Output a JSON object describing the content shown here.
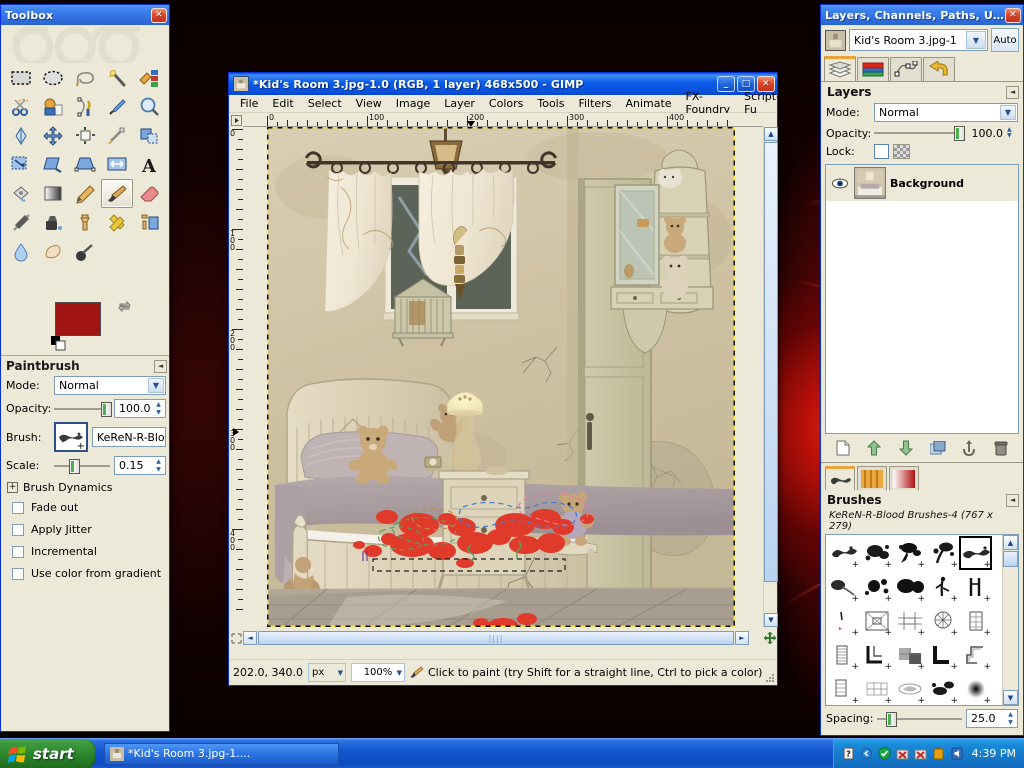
{
  "desktop": {
    "background_color": "#120202",
    "accent_color": "#ff2a12"
  },
  "toolbox": {
    "title": "Toolbox",
    "close_label": "✕",
    "tools": [
      {
        "name": "rect-select-tool",
        "label": "Rectangle Select"
      },
      {
        "name": "ellipse-select-tool",
        "label": "Ellipse Select"
      },
      {
        "name": "free-select-tool",
        "label": "Free Select"
      },
      {
        "name": "fuzzy-select-tool",
        "label": "Fuzzy Select"
      },
      {
        "name": "select-by-color-tool",
        "label": "Select by Color"
      },
      {
        "name": "scissors-select-tool",
        "label": "Scissors Select"
      },
      {
        "name": "foreground-select-tool",
        "label": "Foreground Select"
      },
      {
        "name": "paths-tool",
        "label": "Paths"
      },
      {
        "name": "color-picker-tool",
        "label": "Color Picker"
      },
      {
        "name": "zoom-tool",
        "label": "Zoom"
      },
      {
        "name": "measure-tool",
        "label": "Measure"
      },
      {
        "name": "move-tool",
        "label": "Move"
      },
      {
        "name": "alignment-tool",
        "label": "Alignment"
      },
      {
        "name": "crop-tool",
        "label": "Crop"
      },
      {
        "name": "rotate-tool",
        "label": "Rotate"
      },
      {
        "name": "scale-tool",
        "label": "Scale"
      },
      {
        "name": "shear-tool",
        "label": "Shear"
      },
      {
        "name": "perspective-tool",
        "label": "Perspective"
      },
      {
        "name": "flip-tool",
        "label": "Flip"
      },
      {
        "name": "text-tool",
        "label": "Text"
      },
      {
        "name": "bucket-fill-tool",
        "label": "Bucket Fill"
      },
      {
        "name": "gradient-tool",
        "label": "Blend"
      },
      {
        "name": "pencil-tool",
        "label": "Pencil"
      },
      {
        "name": "paintbrush-tool",
        "label": "Paintbrush"
      },
      {
        "name": "eraser-tool",
        "label": "Eraser"
      },
      {
        "name": "airbrush-tool",
        "label": "Airbrush"
      },
      {
        "name": "ink-tool",
        "label": "Ink"
      },
      {
        "name": "clone-tool",
        "label": "Clone"
      },
      {
        "name": "heal-tool",
        "label": "Heal"
      },
      {
        "name": "perspective-clone-tool",
        "label": "Perspective Clone"
      },
      {
        "name": "blur-sharpen-tool",
        "label": "Blur / Sharpen"
      },
      {
        "name": "smudge-tool",
        "label": "Smudge"
      },
      {
        "name": "dodge-burn-tool",
        "label": "Dodge / Burn"
      }
    ],
    "selected_tool_index": 23,
    "colors": {
      "foreground": "#a01414",
      "background": "#ffffff"
    },
    "tool_options": {
      "title": "Paintbrush",
      "mode_label": "Mode:",
      "mode_value": "Normal",
      "opacity_label": "Opacity:",
      "opacity_value": "100.0",
      "brush_label": "Brush:",
      "brush_value": "KeReN-R-Blood Br",
      "scale_label": "Scale:",
      "scale_value": "0.15",
      "brush_dynamics_label": "Brush Dynamics",
      "checkboxes": [
        {
          "label": "Fade out",
          "checked": false
        },
        {
          "label": "Apply Jitter",
          "checked": false
        },
        {
          "label": "Incremental",
          "checked": false
        },
        {
          "label": "Use color from gradient",
          "checked": false
        }
      ]
    }
  },
  "image_window": {
    "title": "*Kid's Room 3.jpg-1.0 (RGB, 1 layer) 468x500 - GIMP",
    "minimize_label": "_",
    "maximize_label": "□",
    "close_label": "✕",
    "menus": [
      "File",
      "Edit",
      "Select",
      "View",
      "Image",
      "Layer",
      "Colors",
      "Tools",
      "Filters",
      "Animate",
      "FX-Foundry",
      "Script-Fu"
    ],
    "ruler_h_labels": [
      "0",
      "100",
      "200",
      "300",
      "400"
    ],
    "ruler_v_labels": [
      "0",
      "100",
      "200",
      "300",
      "400"
    ],
    "status": {
      "position": "202.0, 340.0",
      "unit": "px",
      "zoom": "100%",
      "message": "Click to paint (try Shift for a straight line, Ctrl to pick a color)"
    }
  },
  "dock": {
    "title": "Layers, Channels, Paths, Undo -...",
    "close_label": "✕",
    "image_name": "Kid's Room 3.jpg-1",
    "auto_label": "Auto",
    "tabs": [
      {
        "name": "layers-tab",
        "label": "Layers"
      },
      {
        "name": "channels-tab",
        "label": "Channels"
      },
      {
        "name": "paths-tab",
        "label": "Paths"
      },
      {
        "name": "undo-history-tab",
        "label": "Undo History"
      }
    ],
    "active_tab": 0,
    "layers_panel": {
      "title": "Layers",
      "mode_label": "Mode:",
      "mode_value": "Normal",
      "opacity_label": "Opacity:",
      "opacity_value": "100.0",
      "lock_label": "Lock:",
      "layers": [
        {
          "name": "Background",
          "visible": true,
          "selected": true
        }
      ],
      "buttons": [
        {
          "name": "new-layer-button",
          "label": "New Layer"
        },
        {
          "name": "raise-layer-button",
          "label": "Raise Layer"
        },
        {
          "name": "lower-layer-button",
          "label": "Lower Layer"
        },
        {
          "name": "duplicate-layer-button",
          "label": "Duplicate Layer"
        },
        {
          "name": "anchor-layer-button",
          "label": "Anchor Layer"
        },
        {
          "name": "delete-layer-button",
          "label": "Delete Layer"
        }
      ]
    },
    "brushes_panel": {
      "tabs": [
        {
          "name": "brushes-tab",
          "label": "Brushes"
        },
        {
          "name": "patterns-tab",
          "label": "Patterns"
        },
        {
          "name": "gradients-tab",
          "label": "Gradients"
        }
      ],
      "active_tab": 0,
      "title": "Brushes",
      "selected_brush": "KeReN-R-Blood Brushes-4 (767 x 279)",
      "spacing_label": "Spacing:",
      "spacing_value": "25.0"
    }
  },
  "taskbar": {
    "start_label": "start",
    "tasks": [
      {
        "name": "taskbar-item-gimp",
        "label": "*Kid's Room 3.jpg-1...."
      }
    ],
    "tray_icons": [
      "help-icon",
      "chevron-left-icon",
      "shield-icon",
      "antivirus-icon",
      "network-icon",
      "battery-icon",
      "volume-icon"
    ],
    "clock": "4:39 PM"
  }
}
